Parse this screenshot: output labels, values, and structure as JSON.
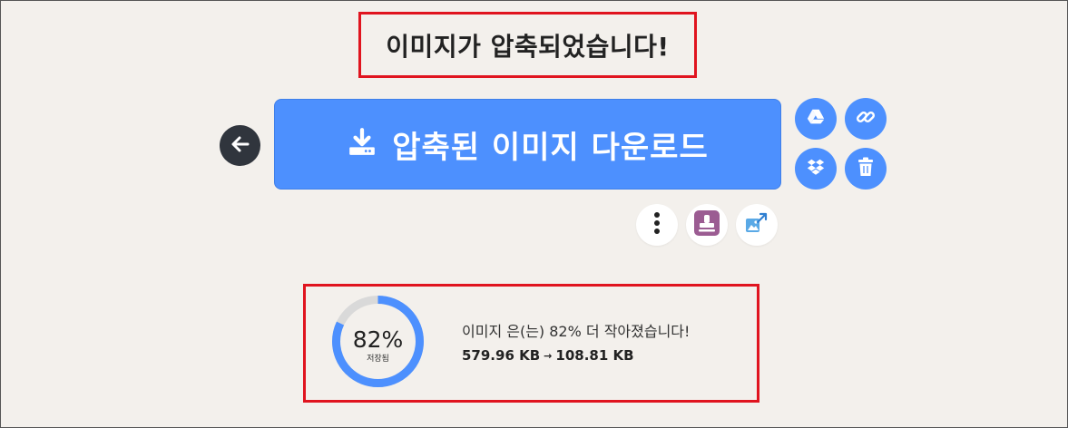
{
  "header": {
    "title": "이미지가 압축되었습니다!"
  },
  "actions": {
    "download_label": "압축된 이미지 다운로드",
    "back_icon": "arrow-left-icon",
    "download_icon": "download-tray-icon",
    "side_icons": [
      "google-drive-icon",
      "link-icon",
      "dropbox-icon",
      "trash-icon"
    ],
    "extra_icons": [
      "more-vertical-icon",
      "stamp-icon",
      "resize-image-icon"
    ]
  },
  "result": {
    "percent": "82%",
    "saved_label": "저장됨",
    "saved_fraction": 0.82,
    "message": "이미지 은(는) 82% 더 작아졌습니다!",
    "original_size": "579.96 KB",
    "arrow": "→",
    "compressed_size": "108.81 KB"
  },
  "colors": {
    "accent": "#4d90fe",
    "background": "#f3f0ec",
    "highlight_border": "#e0141f",
    "dark_button": "#30353d",
    "donut_track": "#d9d9d9",
    "stamp_purple": "#9b5c92"
  }
}
